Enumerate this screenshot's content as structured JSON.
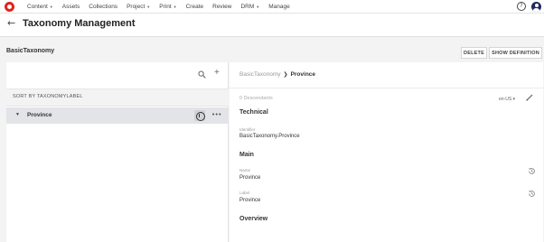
{
  "nav": {
    "items": [
      {
        "label": "Content",
        "has_caret": true
      },
      {
        "label": "Assets",
        "has_caret": false
      },
      {
        "label": "Collections",
        "has_caret": false
      },
      {
        "label": "Project",
        "has_caret": true
      },
      {
        "label": "Print",
        "has_caret": true
      },
      {
        "label": "Create",
        "has_caret": false
      },
      {
        "label": "Review",
        "has_caret": false
      },
      {
        "label": "DRM",
        "has_caret": true
      },
      {
        "label": "Manage",
        "has_caret": false
      }
    ],
    "help_glyph": "?",
    "brand_color": "#e0241b",
    "avatar_color": "#1f2b58"
  },
  "header": {
    "back_glyph": "←",
    "title": "Taxonomy Management"
  },
  "taxonomy": {
    "name": "BasicTaxonomy",
    "delete_label": "DELETE",
    "show_definition_label": "SHOW DEFINITION"
  },
  "tree": {
    "plus_glyph": "+",
    "sort_label": "SORT BY TAXONOMYLABEL",
    "rows": [
      {
        "label": "Province",
        "caret": "▼",
        "selected": true
      }
    ],
    "more_glyph": "•••"
  },
  "detail": {
    "breadcrumb": {
      "root": "BasicTaxonomy",
      "separator": "❯",
      "current": "Province"
    },
    "descendants": "0 Descendants",
    "language": "en-US ▾",
    "sections": {
      "technical": "Technical",
      "main": "Main",
      "overview": "Overview"
    },
    "fields": {
      "identifier_label": "Identifier",
      "identifier_value": "BasicTaxonomy.Province",
      "name_label": "Name",
      "name_value": "Province",
      "label_label": "Label",
      "label_value": "Province"
    }
  }
}
